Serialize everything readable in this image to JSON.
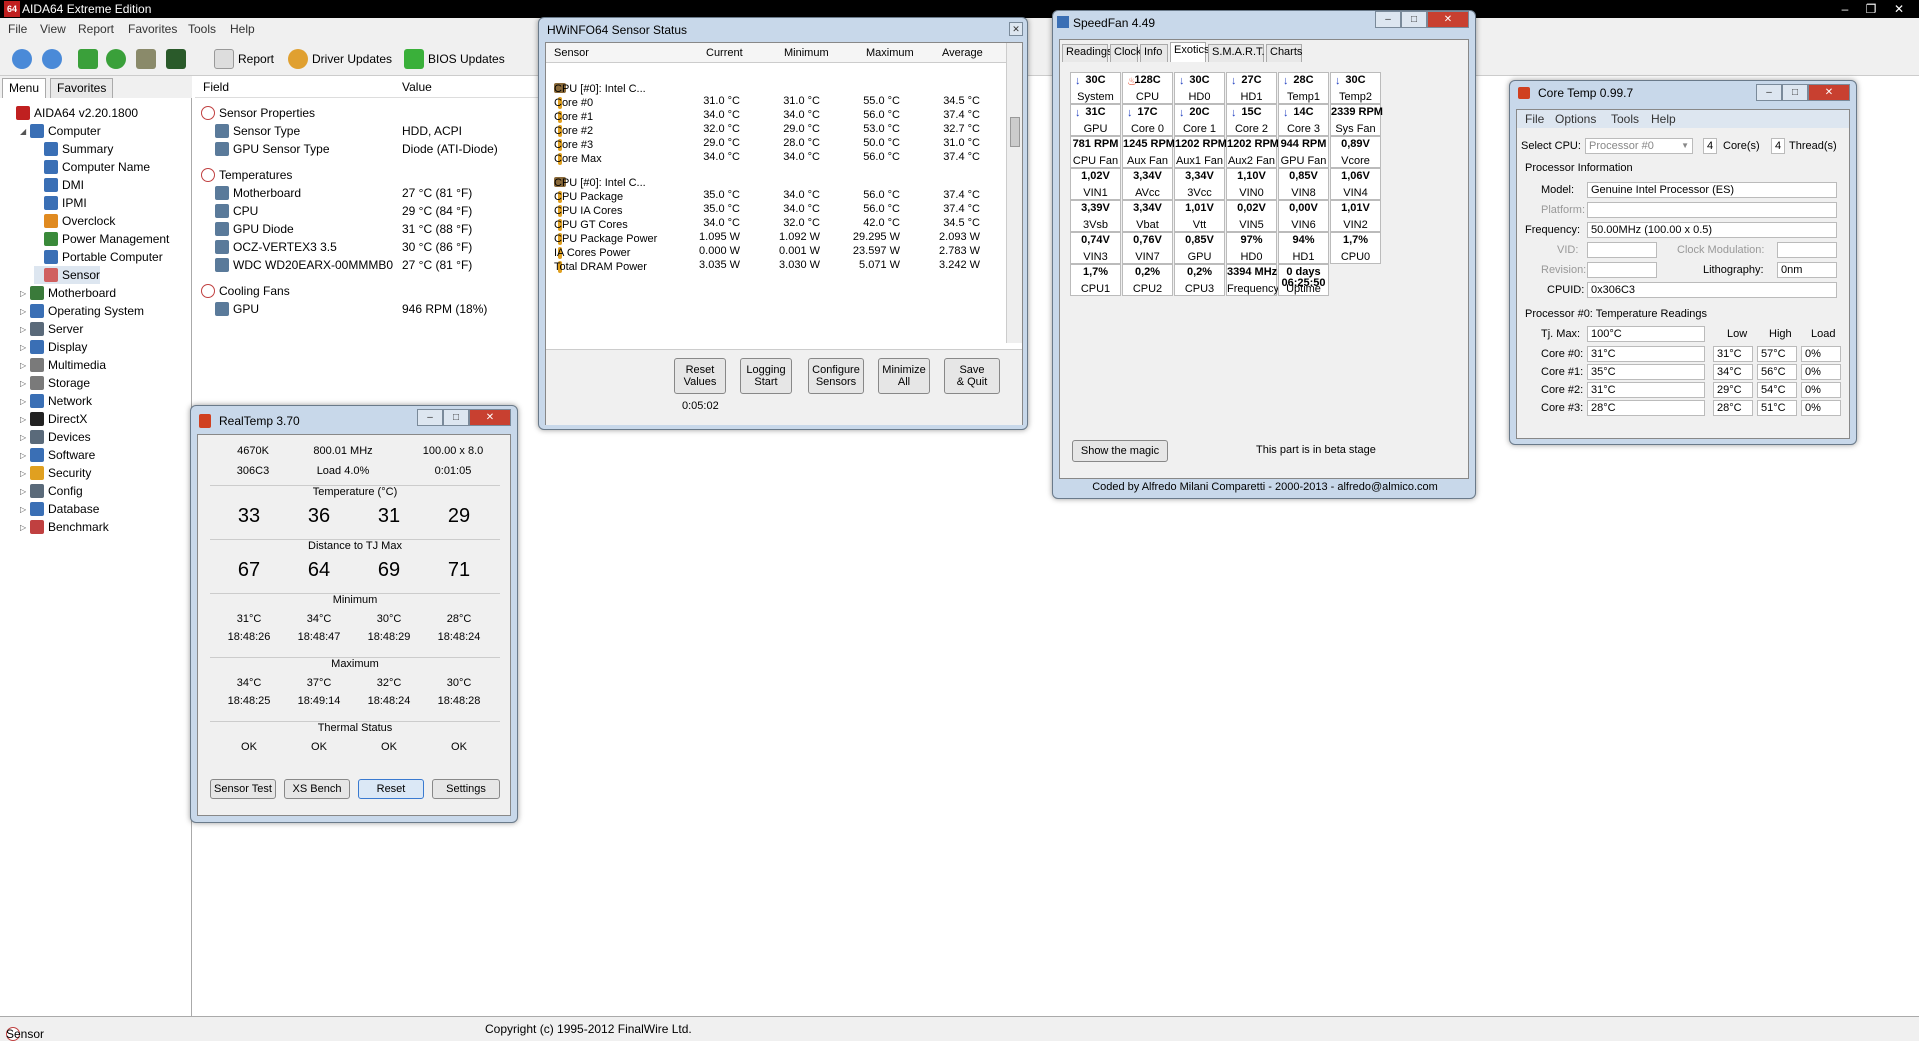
{
  "aida": {
    "title": "AIDA64 Extreme Edition",
    "app_icon": "64",
    "menu": [
      "File",
      "View",
      "Report",
      "Favorites",
      "Tools",
      "Help"
    ],
    "toolbar": {
      "report": "Report",
      "driver": "Driver Updates",
      "bios": "BIOS Updates"
    },
    "tabs": [
      "Menu",
      "Favorites"
    ],
    "tree": [
      {
        "label": "AIDA64 v2.20.1800",
        "indent": 0,
        "exp": "",
        "color": "#c02020"
      },
      {
        "label": "Computer",
        "indent": 1,
        "exp": "◢",
        "color": "#3a6fb5"
      },
      {
        "label": "Summary",
        "indent": 2,
        "exp": "",
        "color": "#3a6fb5"
      },
      {
        "label": "Computer Name",
        "indent": 2,
        "exp": "",
        "color": "#3a6fb5"
      },
      {
        "label": "DMI",
        "indent": 2,
        "exp": "",
        "color": "#3a6fb5"
      },
      {
        "label": "IPMI",
        "indent": 2,
        "exp": "",
        "color": "#3a6fb5"
      },
      {
        "label": "Overclock",
        "indent": 2,
        "exp": "",
        "color": "#e08a20"
      },
      {
        "label": "Power Management",
        "indent": 2,
        "exp": "",
        "color": "#3a8a3a"
      },
      {
        "label": "Portable Computer",
        "indent": 2,
        "exp": "",
        "color": "#3a6fb5"
      },
      {
        "label": "Sensor",
        "indent": 2,
        "exp": "",
        "color": "#d06060"
      },
      {
        "label": "Motherboard",
        "indent": 1,
        "exp": "▷",
        "color": "#3a7a3a"
      },
      {
        "label": "Operating System",
        "indent": 1,
        "exp": "▷",
        "color": "#3a6fb5"
      },
      {
        "label": "Server",
        "indent": 1,
        "exp": "▷",
        "color": "#5a6a7a"
      },
      {
        "label": "Display",
        "indent": 1,
        "exp": "▷",
        "color": "#3a6fb5"
      },
      {
        "label": "Multimedia",
        "indent": 1,
        "exp": "▷",
        "color": "#7a7a7a"
      },
      {
        "label": "Storage",
        "indent": 1,
        "exp": "▷",
        "color": "#7a7a7a"
      },
      {
        "label": "Network",
        "indent": 1,
        "exp": "▷",
        "color": "#3a6fb5"
      },
      {
        "label": "DirectX",
        "indent": 1,
        "exp": "▷",
        "color": "#222"
      },
      {
        "label": "Devices",
        "indent": 1,
        "exp": "▷",
        "color": "#5a6a7a"
      },
      {
        "label": "Software",
        "indent": 1,
        "exp": "▷",
        "color": "#3a6fb5"
      },
      {
        "label": "Security",
        "indent": 1,
        "exp": "▷",
        "color": "#e0a020"
      },
      {
        "label": "Config",
        "indent": 1,
        "exp": "▷",
        "color": "#5a6a7a"
      },
      {
        "label": "Database",
        "indent": 1,
        "exp": "▷",
        "color": "#3a6fb5"
      },
      {
        "label": "Benchmark",
        "indent": 1,
        "exp": "▷",
        "color": "#c04040"
      }
    ],
    "columns": {
      "field": "Field",
      "value": "Value"
    },
    "rows": [
      {
        "f": "Sensor Properties",
        "v": "",
        "lvl": 0,
        "gap": 0
      },
      {
        "f": "Sensor Type",
        "v": "HDD, ACPI",
        "lvl": 1,
        "gap": 0
      },
      {
        "f": "GPU Sensor Type",
        "v": "Diode  (ATI-Diode)",
        "lvl": 1,
        "gap": 0
      },
      {
        "f": "Temperatures",
        "v": "",
        "lvl": 0,
        "gap": 1
      },
      {
        "f": "Motherboard",
        "v": "27 °C  (81 °F)",
        "lvl": 1,
        "gap": 0
      },
      {
        "f": "CPU",
        "v": "29 °C  (84 °F)",
        "lvl": 1,
        "gap": 0
      },
      {
        "f": "GPU Diode",
        "v": "31 °C  (88 °F)",
        "lvl": 1,
        "gap": 0
      },
      {
        "f": "OCZ-VERTEX3 3.5",
        "v": "30 °C  (86 °F)",
        "lvl": 1,
        "gap": 0
      },
      {
        "f": "WDC WD20EARX-00MMMB0",
        "v": "27 °C  (81 °F)",
        "lvl": 1,
        "gap": 0
      },
      {
        "f": "Cooling Fans",
        "v": "",
        "lvl": 0,
        "gap": 1
      },
      {
        "f": "GPU",
        "v": "946 RPM  (18%)",
        "lvl": 1,
        "gap": 0
      }
    ],
    "status_left": "Sensor",
    "status_right": "Copyright (c) 1995-2012 FinalWire Ltd."
  },
  "hwinfo": {
    "title": "HWiNFO64 Sensor Status",
    "headers": [
      "Sensor",
      "Current",
      "Minimum",
      "Maximum",
      "Average"
    ],
    "rows": [
      {
        "n": "CPU [#0]: Intel C...",
        "c": "",
        "mi": "",
        "ma": "",
        "a": "",
        "grp": true
      },
      {
        "n": "Core #0",
        "c": "31.0 °C",
        "mi": "31.0 °C",
        "ma": "55.0 °C",
        "a": "34.5 °C"
      },
      {
        "n": "Core #1",
        "c": "34.0 °C",
        "mi": "34.0 °C",
        "ma": "56.0 °C",
        "a": "37.4 °C"
      },
      {
        "n": "Core #2",
        "c": "32.0 °C",
        "mi": "29.0 °C",
        "ma": "53.0 °C",
        "a": "32.7 °C"
      },
      {
        "n": "Core #3",
        "c": "29.0 °C",
        "mi": "28.0 °C",
        "ma": "50.0 °C",
        "a": "31.0 °C"
      },
      {
        "n": "Core Max",
        "c": "34.0 °C",
        "mi": "34.0 °C",
        "ma": "56.0 °C",
        "a": "37.4 °C"
      },
      {
        "n": "",
        "c": "",
        "mi": "",
        "ma": "",
        "a": "",
        "gap": true
      },
      {
        "n": "CPU [#0]: Intel C...",
        "c": "",
        "mi": "",
        "ma": "",
        "a": "",
        "grp": true
      },
      {
        "n": "CPU Package",
        "c": "35.0 °C",
        "mi": "34.0 °C",
        "ma": "56.0 °C",
        "a": "37.4 °C"
      },
      {
        "n": "CPU IA Cores",
        "c": "35.0 °C",
        "mi": "34.0 °C",
        "ma": "56.0 °C",
        "a": "37.4 °C"
      },
      {
        "n": "CPU GT Cores",
        "c": "34.0 °C",
        "mi": "32.0 °C",
        "ma": "42.0 °C",
        "a": "34.5 °C"
      },
      {
        "n": "CPU Package Power",
        "c": "1.095 W",
        "mi": "1.092 W",
        "ma": "29.295 W",
        "a": "2.093 W"
      },
      {
        "n": "IA Cores Power",
        "c": "0.000 W",
        "mi": "0.001 W",
        "ma": "23.597 W",
        "a": "2.783 W"
      },
      {
        "n": "Total DRAM Power",
        "c": "3.035 W",
        "mi": "3.030 W",
        "ma": "5.071 W",
        "a": "3.242 W"
      }
    ],
    "buttons": [
      "Reset\nValues",
      "Logging\nStart",
      "Configure\nSensors",
      "Minimize\nAll",
      "Save\n& Quit"
    ],
    "timer": "0:05:02"
  },
  "speedfan": {
    "title": "SpeedFan 4.49",
    "tabs": [
      "Readings",
      "Clock",
      "Info",
      "Exotics",
      "S.M.A.R.T.",
      "Charts"
    ],
    "cells": [
      [
        "30C",
        "System"
      ],
      [
        "128C",
        "CPU"
      ],
      [
        "30C",
        "HD0"
      ],
      [
        "27C",
        "HD1"
      ],
      [
        "28C",
        "Temp1"
      ],
      [
        "30C",
        "Temp2"
      ],
      [
        "31C",
        "GPU"
      ],
      [
        "17C",
        "Core 0"
      ],
      [
        "20C",
        "Core 1"
      ],
      [
        "15C",
        "Core 2"
      ],
      [
        "14C",
        "Core 3"
      ],
      [
        "2339 RPM",
        "Sys Fan"
      ],
      [
        "781 RPM",
        "CPU Fan"
      ],
      [
        "1245 RPM",
        "Aux Fan"
      ],
      [
        "1202 RPM",
        "Aux1 Fan"
      ],
      [
        "1202 RPM",
        "Aux2 Fan"
      ],
      [
        "944 RPM",
        "GPU Fan"
      ],
      [
        "0,89V",
        "Vcore"
      ],
      [
        "1,02V",
        "VIN1"
      ],
      [
        "3,34V",
        "AVcc"
      ],
      [
        "3,34V",
        "3Vcc"
      ],
      [
        "1,10V",
        "VIN0"
      ],
      [
        "0,85V",
        "VIN8"
      ],
      [
        "1,06V",
        "VIN4"
      ],
      [
        "3,39V",
        "3Vsb"
      ],
      [
        "3,34V",
        "Vbat"
      ],
      [
        "1,01V",
        "Vtt"
      ],
      [
        "0,02V",
        "VIN5"
      ],
      [
        "0,00V",
        "VIN6"
      ],
      [
        "1,01V",
        "VIN2"
      ],
      [
        "0,74V",
        "VIN3"
      ],
      [
        "0,76V",
        "VIN7"
      ],
      [
        "0,85V",
        "GPU Vddc"
      ],
      [
        "97%",
        "HD0"
      ],
      [
        "94%",
        "HD1"
      ],
      [
        "1,7%",
        "CPU0"
      ],
      [
        "1,7%",
        "CPU1"
      ],
      [
        "0,2%",
        "CPU2"
      ],
      [
        "0,2%",
        "CPU3"
      ],
      [
        "3394 MHz",
        "Frequency"
      ],
      [
        "0 days\n06:25:50",
        "Uptime"
      ]
    ],
    "magic": "Show the magic",
    "beta": "This part is in beta stage",
    "footer": "Coded by Alfredo Milani Comparetti - 2000-2013 - alfredo@almico.com"
  },
  "coretemp": {
    "title": "Core Temp 0.99.7",
    "menu": [
      "File",
      "Options",
      "Tools",
      "Help"
    ],
    "select_cpu": "Select CPU:",
    "processor": "Processor #0",
    "cores_n": "4",
    "cores": "Core(s)",
    "threads_n": "4",
    "threads": "Thread(s)",
    "info_title": "Processor Information",
    "model_l": "Model:",
    "model": "Genuine Intel Processor (ES)",
    "platform_l": "Platform:",
    "freq_l": "Frequency:",
    "freq": "50.00MHz (100.00 x 0.5)",
    "vid_l": "VID:",
    "clockmod_l": "Clock Modulation:",
    "revision_l": "Revision:",
    "litho_l": "Lithography:",
    "litho": "0nm",
    "cpuid_l": "CPUID:",
    "cpuid": "0x306C3",
    "readings_title": "Processor #0: Temperature Readings",
    "tjmax_l": "Tj. Max:",
    "tjmax": "100°C",
    "col_low": "Low",
    "col_high": "High",
    "col_load": "Load",
    "cores_rows": [
      {
        "l": "Core #0:",
        "t": "31°C",
        "lo": "31°C",
        "hi": "57°C",
        "ld": "0%"
      },
      {
        "l": "Core #1:",
        "t": "35°C",
        "lo": "34°C",
        "hi": "56°C",
        "ld": "0%"
      },
      {
        "l": "Core #2:",
        "t": "31°C",
        "lo": "29°C",
        "hi": "54°C",
        "ld": "0%"
      },
      {
        "l": "Core #3:",
        "t": "28°C",
        "lo": "28°C",
        "hi": "51°C",
        "ld": "0%"
      }
    ]
  },
  "realtemp": {
    "title": "RealTemp 3.70",
    "cpu": "4670K",
    "mhz": "800.01 MHz",
    "mult": "100.00 x 8.0",
    "cpuid": "306C3",
    "load": "Load   4.0%",
    "time": "0:01:05",
    "temp_title": "Temperature (°C)",
    "temps": [
      "33",
      "36",
      "31",
      "29"
    ],
    "dist_title": "Distance to TJ Max",
    "dist": [
      "67",
      "64",
      "69",
      "71"
    ],
    "min_title": "Minimum",
    "min_t": [
      "31°C",
      "34°C",
      "30°C",
      "28°C"
    ],
    "min_time": [
      "18:48:26",
      "18:48:47",
      "18:48:29",
      "18:48:24"
    ],
    "max_title": "Maximum",
    "max_t": [
      "34°C",
      "37°C",
      "32°C",
      "30°C"
    ],
    "max_time": [
      "18:48:25",
      "18:49:14",
      "18:48:24",
      "18:48:28"
    ],
    "status_title": "Thermal Status",
    "status": [
      "OK",
      "OK",
      "OK",
      "OK"
    ],
    "buttons": [
      "Sensor Test",
      "XS Bench",
      "Reset",
      "Settings"
    ]
  }
}
